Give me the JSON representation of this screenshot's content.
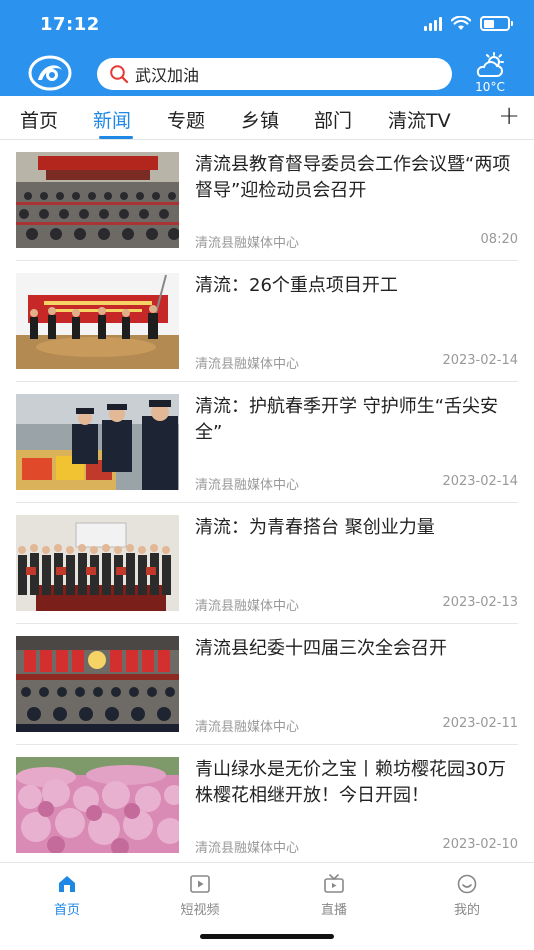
{
  "status_bar": {
    "time": "17:12"
  },
  "header": {
    "search_query": "武汉加油",
    "weather_temp": "10°C",
    "colors": {
      "header_bg": "#2b93ee",
      "accent": "#1f88e5"
    }
  },
  "tabs": [
    {
      "label": "首页"
    },
    {
      "label": "新闻",
      "active": true
    },
    {
      "label": "专题"
    },
    {
      "label": "乡镇"
    },
    {
      "label": "部门"
    },
    {
      "label": "清流TV"
    }
  ],
  "tabs_more": "+",
  "news": [
    {
      "title": "清流县教育督导委员会工作会议暨“两项督导”迎检动员会召开",
      "source": "清流县融媒体中心",
      "date": "08:20",
      "thumb_icon": "meeting-hall-photo"
    },
    {
      "title": "清流：26个重点项目开工",
      "source": "清流县融媒体中心",
      "date": "2023-02-14",
      "thumb_icon": "groundbreaking-ceremony-photo"
    },
    {
      "title": "清流：护航春季开学 守护师生“舌尖安全”",
      "source": "清流县融媒体中心",
      "date": "2023-02-14",
      "thumb_icon": "food-inspection-photo"
    },
    {
      "title": "清流：为青春搭台 聚创业力量",
      "source": "清流县融媒体中心",
      "date": "2023-02-13",
      "thumb_icon": "group-award-photo"
    },
    {
      "title": "清流县纪委十四届三次全会召开",
      "source": "清流县融媒体中心",
      "date": "2023-02-11",
      "thumb_icon": "party-meeting-photo"
    },
    {
      "title": "青山绿水是无价之宝丨赖坊樱花园30万株樱花相继开放！今日开园！",
      "source": "清流县融媒体中心",
      "date": "2023-02-10",
      "thumb_icon": "cherry-blossom-photo"
    }
  ],
  "bottom_nav": [
    {
      "label": "首页",
      "icon": "home-icon",
      "active": true
    },
    {
      "label": "短视频",
      "icon": "short-video-icon"
    },
    {
      "label": "直播",
      "icon": "live-icon"
    },
    {
      "label": "我的",
      "icon": "profile-icon"
    }
  ]
}
